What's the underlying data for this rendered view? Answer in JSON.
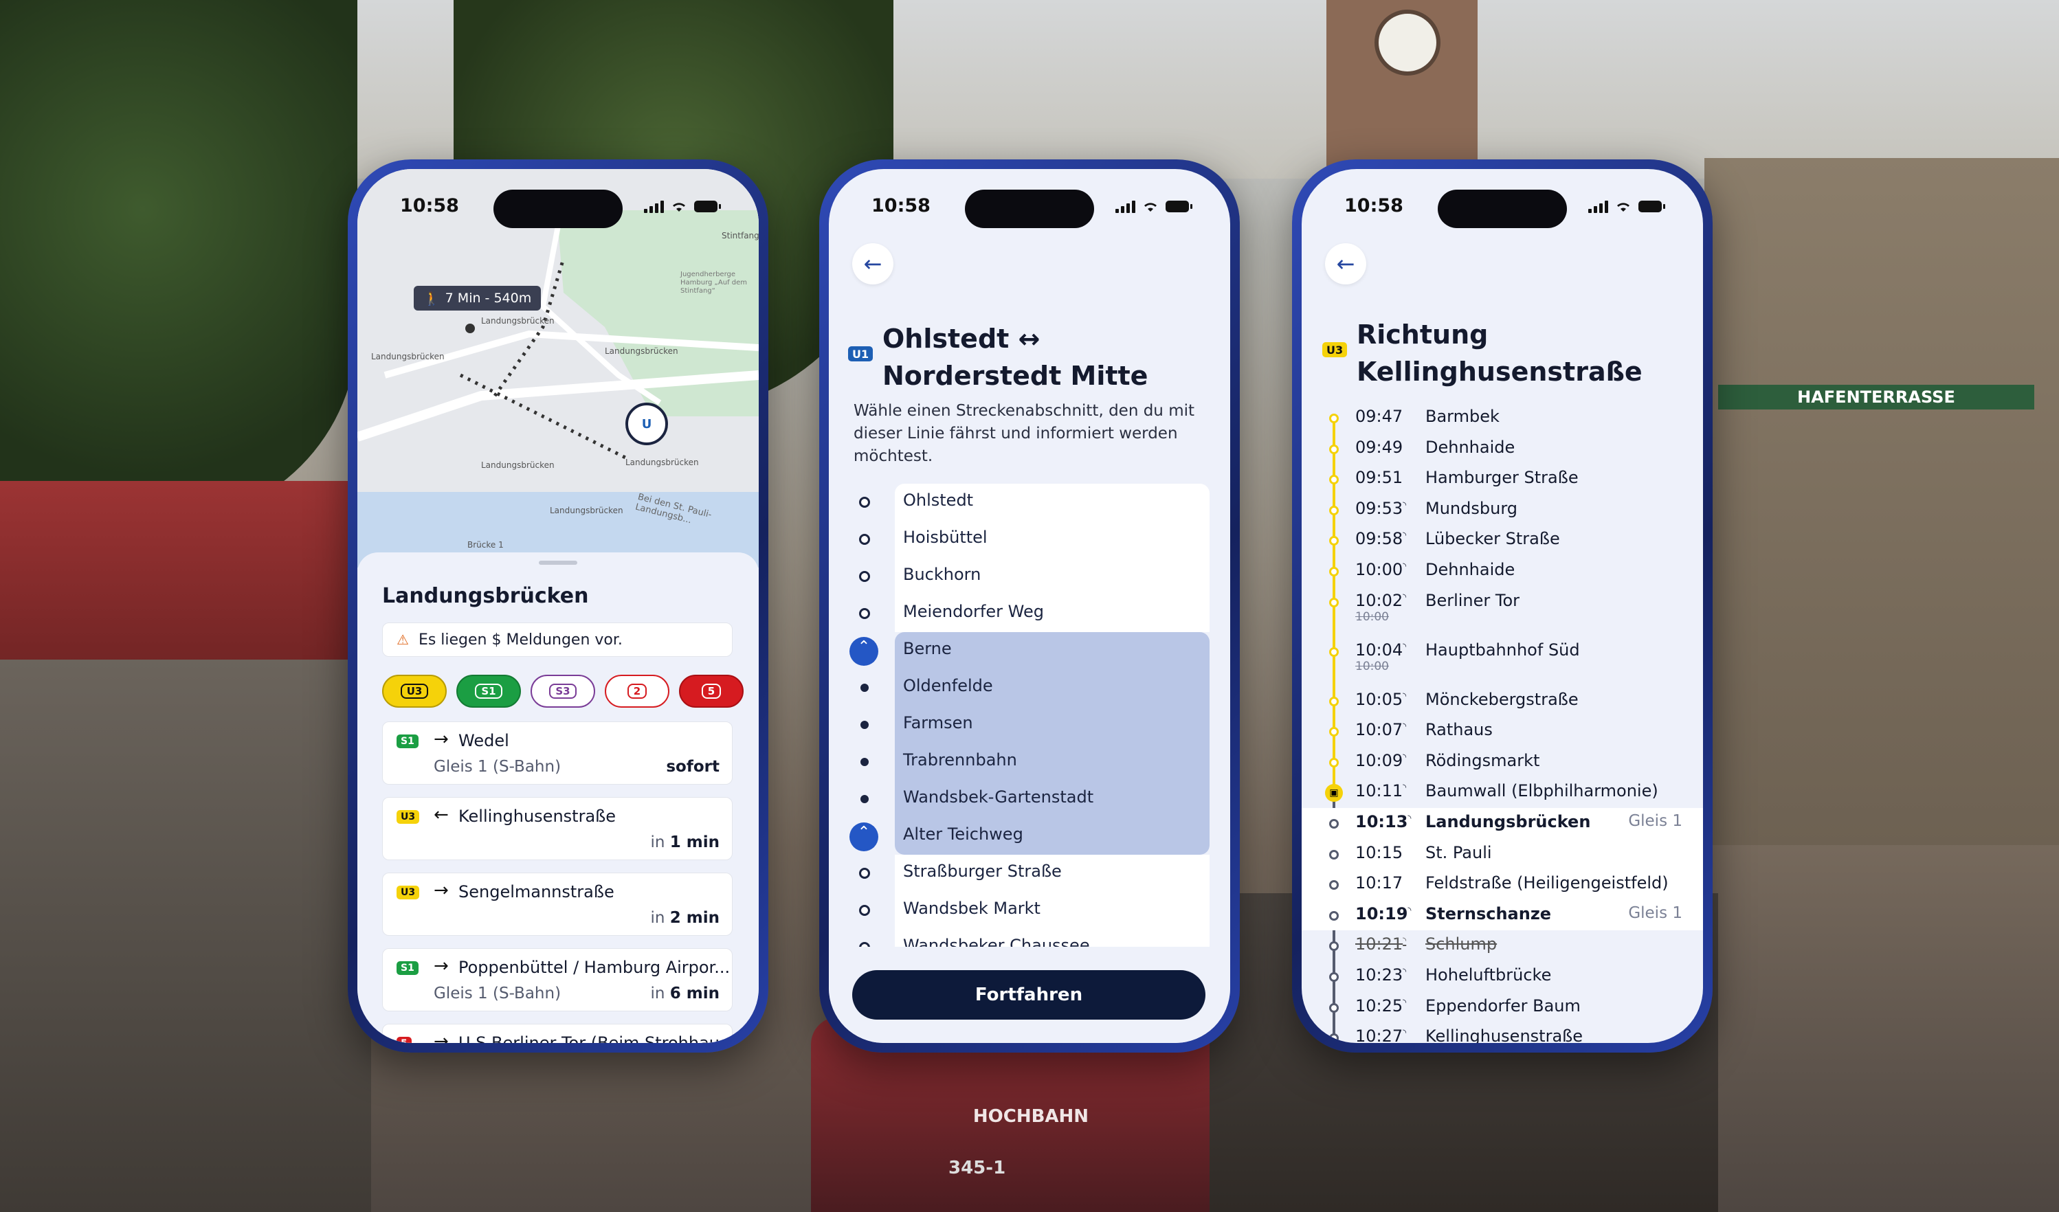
{
  "status_time": "10:58",
  "phone1": {
    "map": {
      "walk_badge": "7 Min - 540m",
      "labels": [
        "Landungsbrücken",
        "Landungsbrücken",
        "Landungsbrücken",
        "Landungsbrücken",
        "Landungsbrücken",
        "Landungsbrücken",
        "Bei den St. Pauli-Landungsb...",
        "Brücke 1",
        "Jugendherberge Hamburg „Auf dem Stintfang“",
        "Stintfang"
      ]
    },
    "station": "Landungsbrücken",
    "alert": "Es liegen $ Meldungen vor.",
    "chips": [
      {
        "label": "U3",
        "bg": "#f5d20a",
        "fg": "#111111",
        "border": "#b89c00"
      },
      {
        "label": "S1",
        "bg": "#1b9e43",
        "fg": "#ffffff",
        "border": "#137a33"
      },
      {
        "label": "S3",
        "bg": "#ffffff",
        "fg": "#7a3c97",
        "border": "#7a3c97"
      },
      {
        "label": "2",
        "bg": "#ffffff",
        "fg": "#d61b20",
        "border": "#d61b20"
      },
      {
        "label": "5",
        "bg": "#d61b20",
        "fg": "#ffffff",
        "border": "#a90f13"
      }
    ],
    "departures": [
      {
        "line": "S1",
        "arrow": "→",
        "dest": "Wedel",
        "platform": "Gleis 1 (S-Bahn)",
        "when_prefix": "",
        "when": "sofort"
      },
      {
        "line": "U3",
        "arrow": "←",
        "dest": "Kellinghusenstraße",
        "platform": "",
        "when_prefix": "in ",
        "when": "1 min"
      },
      {
        "line": "U3",
        "arrow": "→",
        "dest": "Sengelmannstraße",
        "platform": "",
        "when_prefix": "in ",
        "when": "2 min"
      },
      {
        "line": "S1",
        "arrow": "→",
        "dest": "Poppenbüttel / Hamburg Airpor...",
        "platform": "Gleis 1 (S-Bahn)",
        "when_prefix": "in ",
        "when": "6 min"
      },
      {
        "line": "5",
        "arrow": "→",
        "dest": "U S Berliner Tor (Beim Strohhau...",
        "platform": "",
        "when_prefix": "",
        "when": ""
      }
    ]
  },
  "phone2": {
    "line": "U1",
    "title_line1": "Ohlstedt ↔",
    "title_line2": "Norderstedt Mitte",
    "intro": "Wähle einen Streckenabschnitt, den du mit dieser Linie fährst und informiert werden möchtest.",
    "stops": [
      {
        "name": "Ohlstedt",
        "state": "normal"
      },
      {
        "name": "Hoisbüttel",
        "state": "normal"
      },
      {
        "name": "Buckhorn",
        "state": "normal"
      },
      {
        "name": "Meiendorfer Weg",
        "state": "normal"
      },
      {
        "name": "Berne",
        "state": "endpoint"
      },
      {
        "name": "Oldenfelde",
        "state": "selected"
      },
      {
        "name": "Farmsen",
        "state": "selected"
      },
      {
        "name": "Trabrennbahn",
        "state": "selected"
      },
      {
        "name": "Wandsbek-Gartenstadt",
        "state": "selected"
      },
      {
        "name": "Alter Teichweg",
        "state": "endpoint"
      },
      {
        "name": "Straßburger Straße",
        "state": "normal"
      },
      {
        "name": "Wandsbek Markt",
        "state": "normal"
      },
      {
        "name": "Wandsbeker Chaussee",
        "state": "normal"
      }
    ],
    "button": "Fortfahren"
  },
  "phone3": {
    "line": "U3",
    "title_line1": "Richtung",
    "title_line2": "Kellinghusenstraße",
    "rows": [
      {
        "time": "09:47",
        "rt": false,
        "stop": "Barmbek",
        "old": "",
        "gleis": "",
        "style": "past"
      },
      {
        "time": "09:49",
        "rt": false,
        "stop": "Dehnhaide",
        "old": "",
        "gleis": "",
        "style": "past"
      },
      {
        "time": "09:51",
        "rt": false,
        "stop": "Hamburger Straße",
        "old": "",
        "gleis": "",
        "style": "past"
      },
      {
        "time": "09:53",
        "rt": true,
        "stop": "Mundsburg",
        "old": "",
        "gleis": "",
        "style": "past"
      },
      {
        "time": "09:58",
        "rt": true,
        "stop": "Lübecker Straße",
        "old": "",
        "gleis": "",
        "style": "past"
      },
      {
        "time": "10:00",
        "rt": true,
        "stop": "Dehnhaide",
        "old": "",
        "gleis": "",
        "style": "past"
      },
      {
        "time": "10:02",
        "rt": true,
        "stop": "Berliner Tor",
        "old": "10:00",
        "gleis": "",
        "style": "past"
      },
      {
        "time": "10:04",
        "rt": true,
        "stop": "Hauptbahnhof Süd",
        "old": "10:00",
        "gleis": "",
        "style": "past"
      },
      {
        "time": "10:05",
        "rt": true,
        "stop": "Mönckebergstraße",
        "old": "",
        "gleis": "",
        "style": "past"
      },
      {
        "time": "10:07",
        "rt": true,
        "stop": "Rathaus",
        "old": "",
        "gleis": "",
        "style": "past"
      },
      {
        "time": "10:09",
        "rt": true,
        "stop": "Rödingsmarkt",
        "old": "",
        "gleis": "",
        "style": "past"
      },
      {
        "time": "10:11",
        "rt": true,
        "stop": "Baumwall (Elbphilharmonie)",
        "old": "",
        "gleis": "",
        "style": "current"
      },
      {
        "time": "10:13",
        "rt": true,
        "stop": "Landungsbrücken",
        "old": "",
        "gleis": "Gleis 1",
        "style": "bold"
      },
      {
        "time": "10:15",
        "rt": false,
        "stop": "St. Pauli",
        "old": "",
        "gleis": "",
        "style": "hl"
      },
      {
        "time": "10:17",
        "rt": false,
        "stop": "Feldstraße (Heiligengeistfeld)",
        "old": "",
        "gleis": "",
        "style": "hl"
      },
      {
        "time": "10:19",
        "rt": true,
        "stop": "Sternschanze",
        "old": "",
        "gleis": "Gleis 1",
        "style": "bold"
      },
      {
        "time": "10:21",
        "rt": true,
        "stop": "Schlump",
        "old": "",
        "gleis": "",
        "style": "cancel"
      },
      {
        "time": "10:23",
        "rt": true,
        "stop": "Hoheluftbrücke",
        "old": "",
        "gleis": "",
        "style": "future"
      },
      {
        "time": "10:25",
        "rt": true,
        "stop": "Eppendorfer Baum",
        "old": "",
        "gleis": "",
        "style": "future"
      },
      {
        "time": "10:27",
        "rt": true,
        "stop": "Kellinghusenstraße",
        "old": "",
        "gleis": "",
        "style": "future"
      }
    ]
  },
  "background": {
    "sign_hafenterrasse": "HAFENTERRASSE",
    "train_brand": "HOCHBAHN",
    "train_number": "345-1"
  }
}
